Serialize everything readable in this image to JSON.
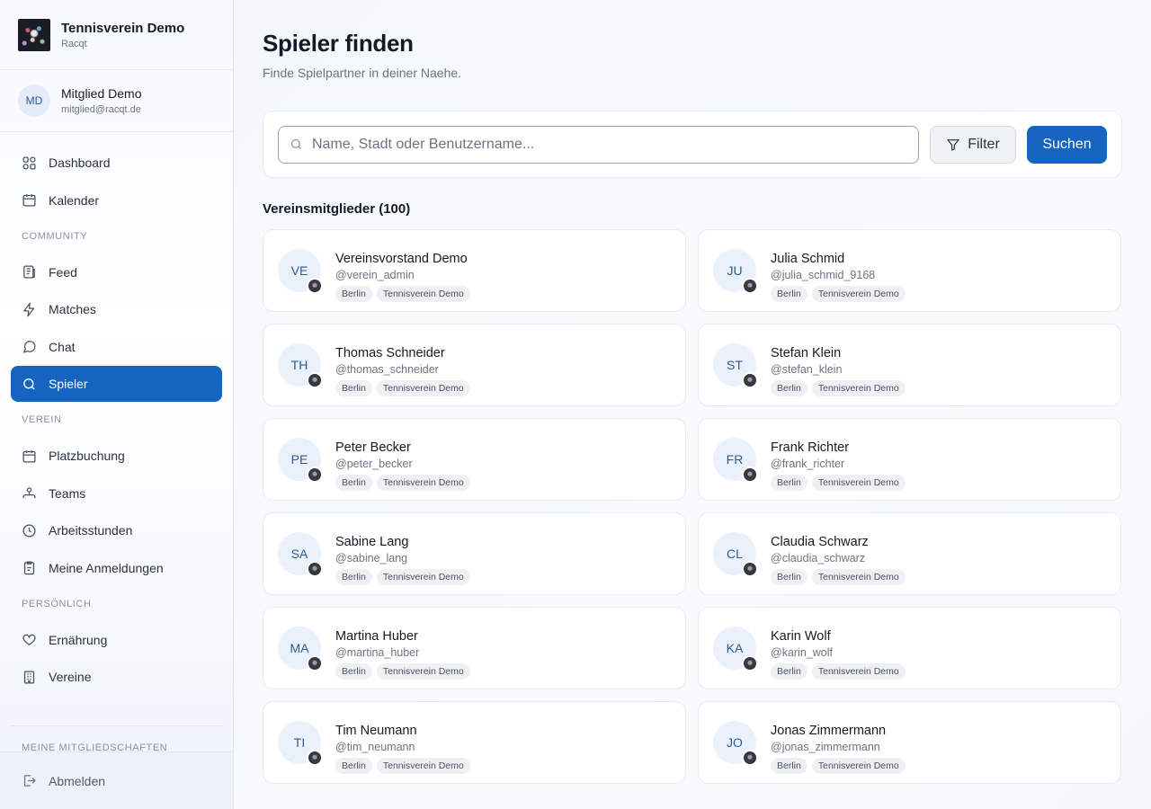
{
  "brand": {
    "name": "Tennisverein Demo",
    "sub": "Racqt"
  },
  "user": {
    "initials": "MD",
    "name": "Mitglied Demo",
    "email": "mitglied@racqt.de"
  },
  "nav": {
    "dashboard": "Dashboard",
    "kalender": "Kalender",
    "section_community": "COMMUNITY",
    "feed": "Feed",
    "matches": "Matches",
    "chat": "Chat",
    "spieler": "Spieler",
    "section_verein": "VEREIN",
    "platzbuchung": "Platzbuchung",
    "teams": "Teams",
    "arbeitsstunden": "Arbeitsstunden",
    "anmeldungen": "Meine Anmeldungen",
    "section_persoenlich": "PERSÖNLICH",
    "ernaehrung": "Ernährung",
    "vereine": "Vereine",
    "section_mitgliedschaften": "MEINE MITGLIEDSCHAFTEN",
    "abmelden": "Abmelden"
  },
  "page": {
    "title": "Spieler finden",
    "subtitle": "Finde Spielpartner in deiner Naehe."
  },
  "search": {
    "placeholder": "Name, Stadt oder Benutzername...",
    "value": "",
    "filter_label": "Filter",
    "submit_label": "Suchen"
  },
  "members": {
    "heading": "Vereinsmitglieder (100)",
    "list": [
      {
        "initials": "VE",
        "name": "Vereinsvorstand Demo",
        "handle": "@verein_admin",
        "city": "Berlin",
        "club": "Tennisverein Demo"
      },
      {
        "initials": "JU",
        "name": "Julia Schmid",
        "handle": "@julia_schmid_9168",
        "city": "Berlin",
        "club": "Tennisverein Demo"
      },
      {
        "initials": "TH",
        "name": "Thomas Schneider",
        "handle": "@thomas_schneider",
        "city": "Berlin",
        "club": "Tennisverein Demo"
      },
      {
        "initials": "ST",
        "name": "Stefan Klein",
        "handle": "@stefan_klein",
        "city": "Berlin",
        "club": "Tennisverein Demo"
      },
      {
        "initials": "PE",
        "name": "Peter Becker",
        "handle": "@peter_becker",
        "city": "Berlin",
        "club": "Tennisverein Demo"
      },
      {
        "initials": "FR",
        "name": "Frank Richter",
        "handle": "@frank_richter",
        "city": "Berlin",
        "club": "Tennisverein Demo"
      },
      {
        "initials": "SA",
        "name": "Sabine Lang",
        "handle": "@sabine_lang",
        "city": "Berlin",
        "club": "Tennisverein Demo"
      },
      {
        "initials": "CL",
        "name": "Claudia Schwarz",
        "handle": "@claudia_schwarz",
        "city": "Berlin",
        "club": "Tennisverein Demo"
      },
      {
        "initials": "MA",
        "name": "Martina Huber",
        "handle": "@martina_huber",
        "city": "Berlin",
        "club": "Tennisverein Demo"
      },
      {
        "initials": "KA",
        "name": "Karin Wolf",
        "handle": "@karin_wolf",
        "city": "Berlin",
        "club": "Tennisverein Demo"
      },
      {
        "initials": "TI",
        "name": "Tim Neumann",
        "handle": "@tim_neumann",
        "city": "Berlin",
        "club": "Tennisverein Demo"
      },
      {
        "initials": "JO",
        "name": "Jonas Zimmermann",
        "handle": "@jonas_zimmermann",
        "city": "Berlin",
        "club": "Tennisverein Demo"
      }
    ]
  },
  "colors": {
    "accent": "#1565c0",
    "avatar_bg": "#eaf1fa",
    "avatar_text": "#2c5a94"
  }
}
